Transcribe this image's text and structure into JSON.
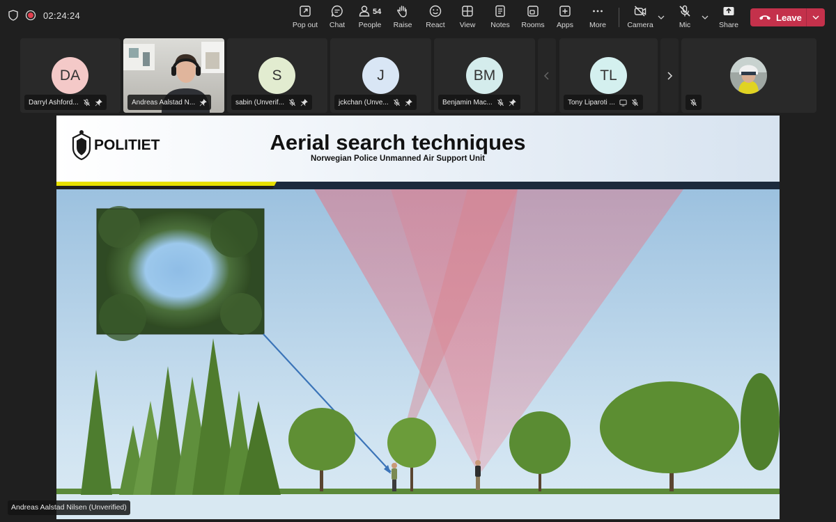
{
  "meeting": {
    "timer": "02:24:24",
    "toolbar": [
      {
        "key": "popout",
        "label": "Pop out",
        "icon": "popout-icon"
      },
      {
        "key": "chat",
        "label": "Chat",
        "icon": "chat-icon"
      },
      {
        "key": "people",
        "label": "People",
        "icon": "people-icon",
        "count": "54"
      },
      {
        "key": "raise",
        "label": "Raise",
        "icon": "hand-icon"
      },
      {
        "key": "react",
        "label": "React",
        "icon": "smile-icon"
      },
      {
        "key": "view",
        "label": "View",
        "icon": "grid-icon"
      },
      {
        "key": "notes",
        "label": "Notes",
        "icon": "notes-icon"
      },
      {
        "key": "rooms",
        "label": "Rooms",
        "icon": "rooms-icon"
      },
      {
        "key": "apps",
        "label": "Apps",
        "icon": "apps-icon"
      },
      {
        "key": "more",
        "label": "More",
        "icon": "more-icon"
      },
      {
        "key": "camera",
        "label": "Camera",
        "icon": "camera-off-icon"
      },
      {
        "key": "mic",
        "label": "Mic",
        "icon": "mic-off-icon"
      },
      {
        "key": "share",
        "label": "Share",
        "icon": "share-icon"
      }
    ],
    "leave_label": "Leave",
    "colors": {
      "leave": "#c4314b",
      "background": "#1f1f1f",
      "tile": "#292929"
    }
  },
  "participants": [
    {
      "initials": "DA",
      "name": "Darryl Ashford...",
      "avatar_color": "#f4c9c8",
      "pinned": true,
      "muted": true
    },
    {
      "initials": "",
      "name": "Andreas Aalstad N...",
      "video": true,
      "pinned": true
    },
    {
      "initials": "S",
      "name": "sabin (Unverif...",
      "avatar_color": "#e2ecd0",
      "pinned": true,
      "muted": true
    },
    {
      "initials": "J",
      "name": "jckchan (Unve...",
      "avatar_color": "#d9e6f5",
      "pinned": true,
      "muted": true
    },
    {
      "initials": "BM",
      "name": "Benjamin Mac...",
      "avatar_color": "#d4ecec",
      "pinned": true,
      "muted": true
    },
    {
      "initials": "TL",
      "name": "Tony Liparoti ...",
      "avatar_color": "#d4f0ef",
      "muted": true
    },
    {
      "initials": "",
      "name": "",
      "photo": true,
      "muted": true
    }
  ],
  "slide": {
    "brand": "POLITIET",
    "title": "Aerial search techniques",
    "subtitle": "Norwegian Police Unmanned Air Support Unit"
  },
  "speaker_caption": "Andreas Aalstad Nilsen (Unverified)"
}
